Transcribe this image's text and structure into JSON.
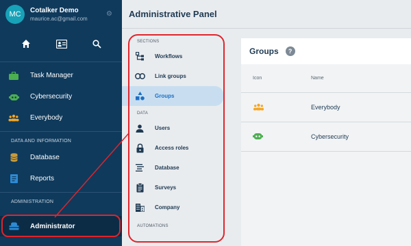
{
  "user": {
    "initials": "MC",
    "name": "Cotalker Demo",
    "email": "maurice.ac@gmail.com"
  },
  "sidebar": {
    "items": [
      {
        "label": "Task Manager",
        "icon": "briefcase-icon",
        "color": "#4caf50"
      },
      {
        "label": "Cybersecurity",
        "icon": "robot-icon",
        "color": "#4caf50"
      },
      {
        "label": "Everybody",
        "icon": "people-icon",
        "color": "#f5a623"
      }
    ],
    "section_data": "DATA AND INFORMATION",
    "data_items": [
      {
        "label": "Database",
        "icon": "database-icon",
        "color": "#c79a3b"
      },
      {
        "label": "Reports",
        "icon": "document-icon",
        "color": "#2d8bd6"
      }
    ],
    "section_admin": "ADMINISTRATION",
    "active_item": {
      "label": "Administrator",
      "icon": "admin-icon",
      "color": "#2d8bd6"
    }
  },
  "header": {
    "title": "Administrative Panel"
  },
  "admin_nav": {
    "sections_label": "SECTIONS",
    "sections": [
      {
        "label": "Workflows",
        "icon": "workflow-icon"
      },
      {
        "label": "Link groups",
        "icon": "link-icon"
      },
      {
        "label": "Groups",
        "icon": "groups-shapes-icon"
      }
    ],
    "data_label": "DATA",
    "data": [
      {
        "label": "Users",
        "icon": "user-icon"
      },
      {
        "label": "Access roles",
        "icon": "lock-icon"
      },
      {
        "label": "Database",
        "icon": "list-icon"
      },
      {
        "label": "Surveys",
        "icon": "clipboard-icon"
      },
      {
        "label": "Company",
        "icon": "building-icon"
      }
    ],
    "automations_label": "AUTOMATIONS"
  },
  "groups": {
    "title": "Groups",
    "columns": {
      "icon": "Icon",
      "name": "Name"
    },
    "rows": [
      {
        "name": "Everybody",
        "icon": "people-icon",
        "color": "#f5a623"
      },
      {
        "name": "Cybersecurity",
        "icon": "robot-icon",
        "color": "#4caf50"
      }
    ]
  },
  "colors": {
    "sidebar_bg": "#0f3a5c",
    "highlight_red": "#e0242b",
    "selected_bg": "#c8def0"
  }
}
